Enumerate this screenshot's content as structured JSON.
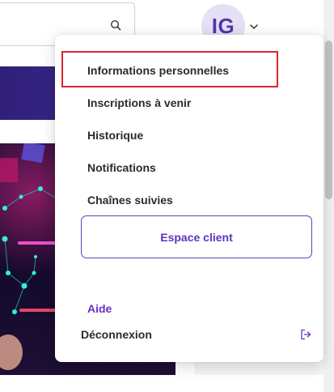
{
  "header": {
    "avatar_initials": "IG",
    "search_icon": "search-icon",
    "avatar_chevron_icon": "chevron-down-icon"
  },
  "menu": {
    "items": [
      {
        "label": "Informations personnelles",
        "highlighted": true
      },
      {
        "label": "Inscriptions à venir"
      },
      {
        "label": "Historique"
      },
      {
        "label": "Notifications"
      },
      {
        "label": "Chaînes suivies"
      }
    ],
    "client_button_label": "Espace client",
    "help_label": "Aide",
    "logout_label": "Déconnexion",
    "logout_icon": "logout-icon"
  },
  "colors": {
    "accent": "#5b34c4",
    "help_link": "#6a2fc4",
    "highlight_border": "#e0232e",
    "avatar_bg": "#e6e0f6",
    "banner": "#30207a"
  }
}
